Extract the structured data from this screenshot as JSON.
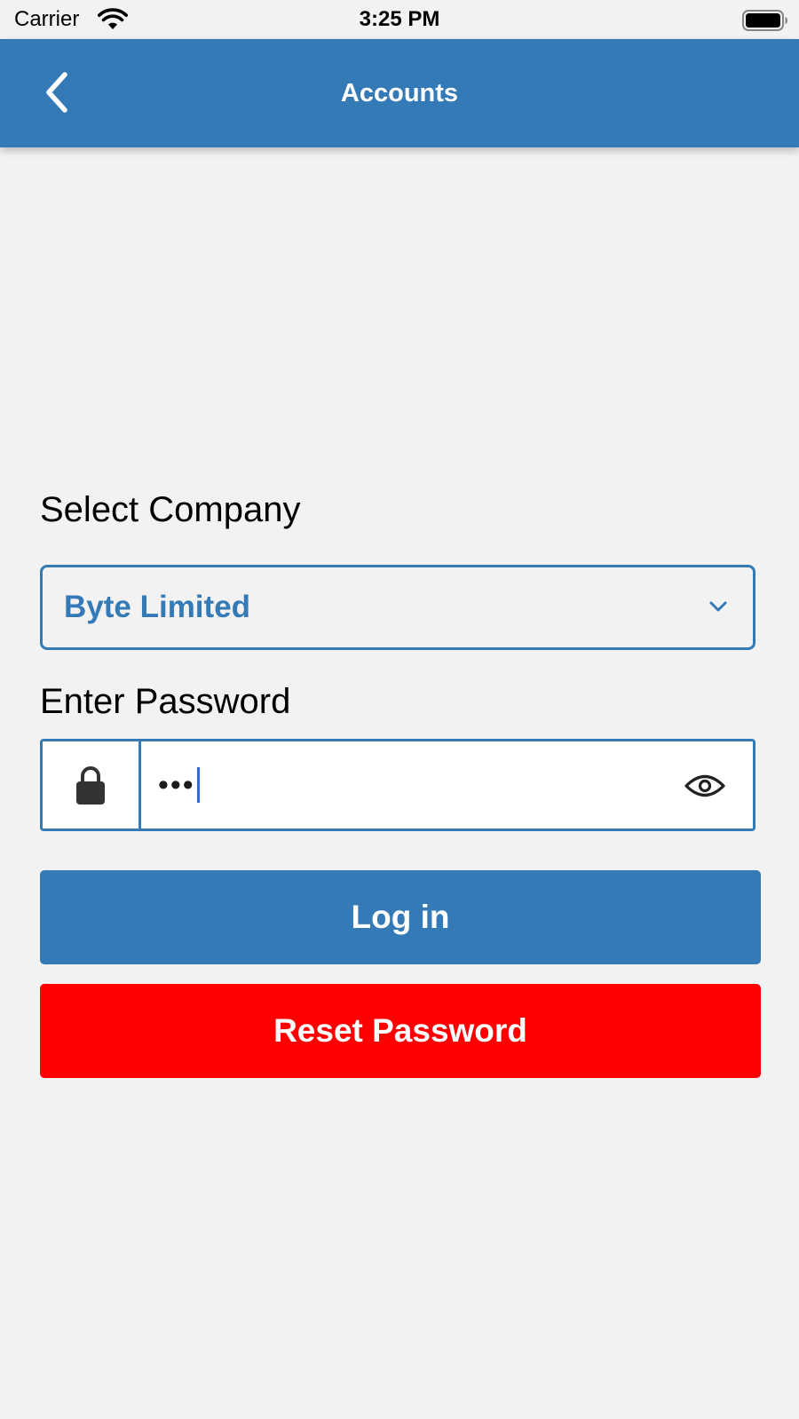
{
  "status_bar": {
    "carrier": "Carrier",
    "time": "3:25 PM"
  },
  "nav": {
    "title": "Accounts",
    "back_icon": "chevron-left-icon"
  },
  "form": {
    "company_label": "Select Company",
    "company_value": "Byte Limited",
    "password_label": "Enter Password",
    "password_masked": "•••",
    "lock_icon": "lock-icon",
    "toggle_icon": "eye-icon"
  },
  "buttons": {
    "login_label": "Log in",
    "reset_label": "Reset Password"
  },
  "colors": {
    "primary": "#347ab6",
    "danger": "#fe0000",
    "background": "#f2f2f2"
  }
}
